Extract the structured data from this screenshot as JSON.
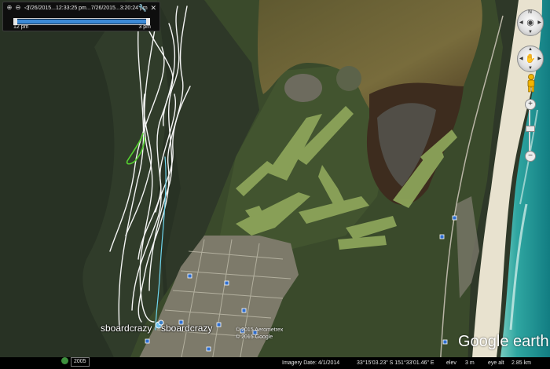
{
  "time_slider": {
    "range_text": "7/26/2015...12:33:25 pm...7/26/2015...3:20:24 pm",
    "left_label": "12 pm",
    "right_label": "3 pm",
    "fill_fraction": 0.97
  },
  "path_labels": [
    "sboardcrazy",
    "sboardcrazy"
  ],
  "copyright": [
    "© 2015 Aerometrex",
    "© 2015 Google"
  ],
  "logo": "Google earth",
  "status": {
    "year": "2005",
    "imagery_date": "Imagery Date: 4/1/2014",
    "coords": "33°15'03.23\" S  151°33'01.46\" E",
    "elev": "elev",
    "elev_value": "3 m",
    "eye_alt": "eye alt",
    "eye_alt_value": "2.85 km"
  },
  "nav": {
    "north": "N"
  },
  "icons": [
    "zoom-in-icon",
    "zoom-out-icon",
    "play-icon",
    "wrench-icon",
    "close-icon",
    "eye-icon",
    "hand-icon",
    "pegman-icon",
    "zoom-plus-icon",
    "zoom-minus-icon",
    "tour-icon"
  ],
  "colors": {
    "lake": "#2f3a2a",
    "forest": "#3b4a2c",
    "fairway": "#8ba65a",
    "beach": "#e9e2cf",
    "ocean": "#1d8d89",
    "track_white": "#ffffff",
    "track_cyan": "#6fd7f0",
    "track_green": "#55d030"
  }
}
